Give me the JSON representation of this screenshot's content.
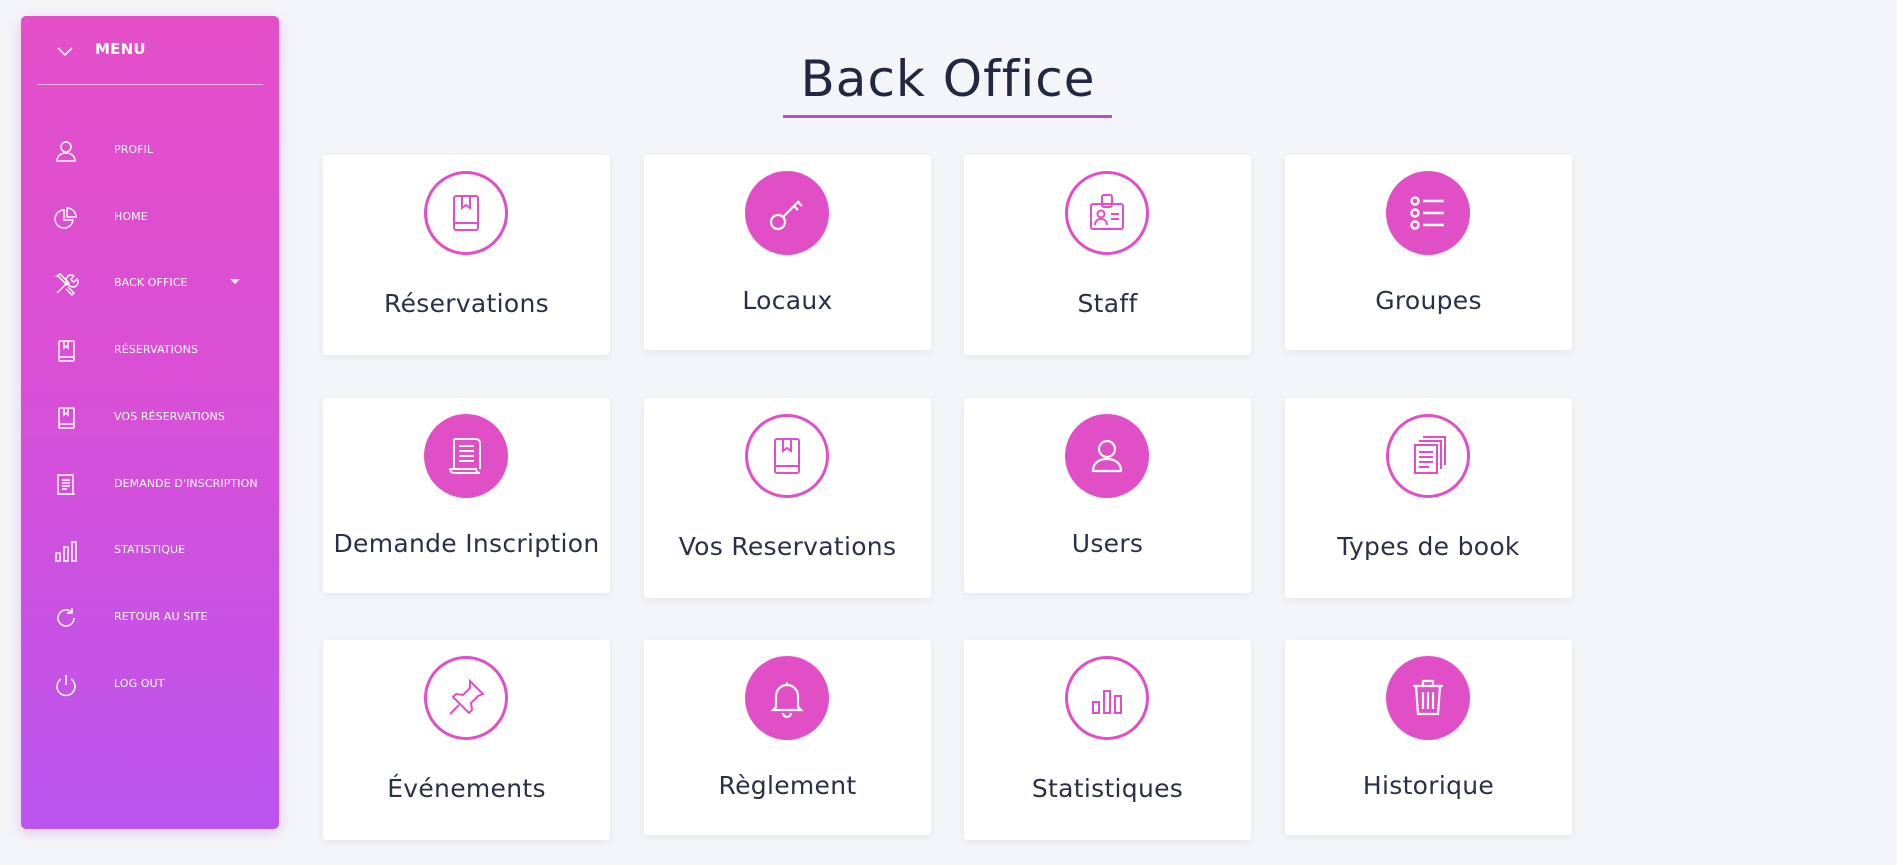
{
  "sidebar": {
    "menu_label": "MENU",
    "items": [
      {
        "label": "PROFIL",
        "icon": "user-icon"
      },
      {
        "label": "HOME",
        "icon": "pie-chart-icon"
      },
      {
        "label": "BACK OFFICE",
        "icon": "tools-icon",
        "has_dropdown": true
      },
      {
        "label": "RÉSERVATIONS",
        "icon": "book-icon"
      },
      {
        "label": "VOS RÉSERVATIONS",
        "icon": "book-icon"
      },
      {
        "label": "DEMANDE D'INSCRIPTION",
        "icon": "document-icon"
      },
      {
        "label": "STATISTIQUE",
        "icon": "bar-chart-icon"
      },
      {
        "label": "RETOUR AU SITE",
        "icon": "refresh-icon"
      },
      {
        "label": "LOG OUT",
        "icon": "power-icon"
      }
    ]
  },
  "main": {
    "title": "Back Office",
    "cards": [
      {
        "label": "Réservations",
        "icon": "book-icon",
        "style": "outline"
      },
      {
        "label": "Locaux",
        "icon": "key-icon",
        "style": "filled"
      },
      {
        "label": "Staff",
        "icon": "id-badge-icon",
        "style": "outline"
      },
      {
        "label": "Groupes",
        "icon": "list-icon",
        "style": "filled"
      },
      {
        "label": "Demande Inscription",
        "icon": "scroll-icon",
        "style": "filled"
      },
      {
        "label": "Vos Reservations",
        "icon": "book-icon",
        "style": "outline"
      },
      {
        "label": "Users",
        "icon": "user-icon",
        "style": "filled"
      },
      {
        "label": "Types de book",
        "icon": "documents-icon",
        "style": "outline"
      },
      {
        "label": "Événements",
        "icon": "pin-icon",
        "style": "outline"
      },
      {
        "label": "Règlement",
        "icon": "bell-icon",
        "style": "filled"
      },
      {
        "label": "Statistiques",
        "icon": "bar-chart-icon",
        "style": "outline"
      },
      {
        "label": "Historique",
        "icon": "trash-icon",
        "style": "filled"
      }
    ]
  },
  "colors": {
    "accent": "#e04fc6",
    "gradient_top": "#e44fc8",
    "gradient_bottom": "#bb55f0",
    "title_underline": "#b054c4",
    "background": "#f4f5f9",
    "text_dark": "#2a3048"
  }
}
